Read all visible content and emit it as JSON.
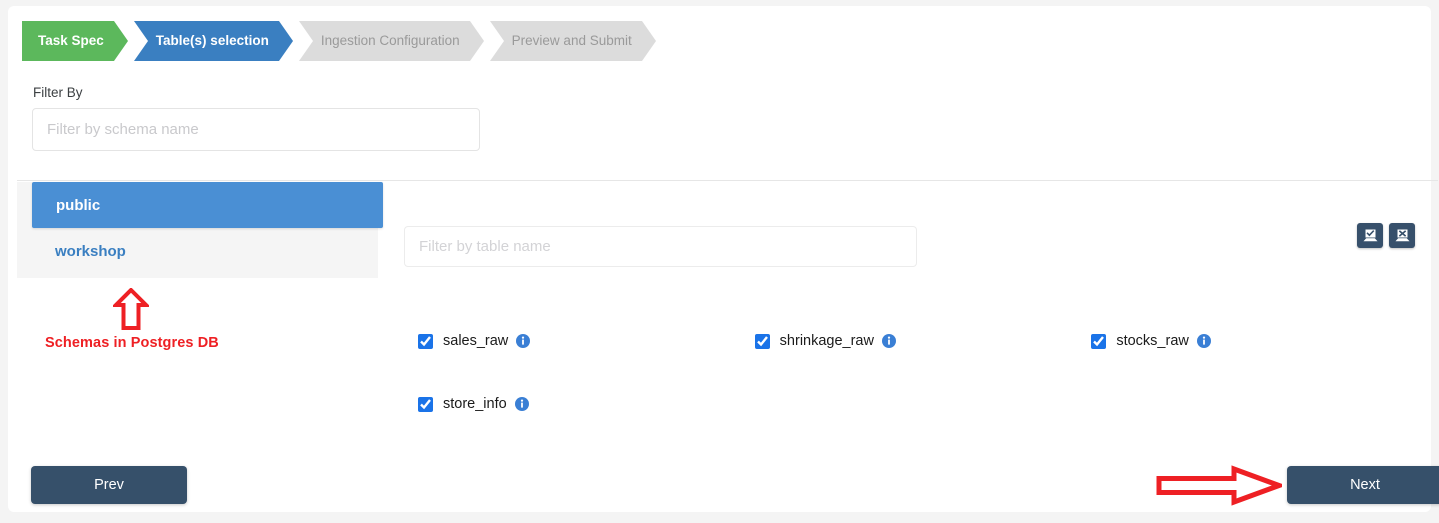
{
  "wizard": {
    "steps": [
      {
        "label": "Task Spec",
        "state": "done"
      },
      {
        "label": "Table(s) selection",
        "state": "active"
      },
      {
        "label": "Ingestion Configuration",
        "state": "todo"
      },
      {
        "label": "Preview and Submit",
        "state": "todo"
      }
    ]
  },
  "schema_filter": {
    "label": "Filter By",
    "placeholder": "Filter by schema name",
    "value": ""
  },
  "sidebar": {
    "items": [
      {
        "label": "public",
        "selected": true
      },
      {
        "label": "workshop",
        "selected": false
      }
    ]
  },
  "annotations": {
    "up_arrow_caption": "Schemas in Postgres DB",
    "color": "#ee2024"
  },
  "table_filter": {
    "placeholder": "Filter by table name",
    "value": ""
  },
  "bulk_actions": [
    {
      "name": "select-all",
      "icon": "check-all-icon"
    },
    {
      "name": "deselect-all",
      "icon": "uncheck-all-icon"
    }
  ],
  "tables": [
    {
      "name": "sales_raw",
      "checked": true,
      "info": "info-icon"
    },
    {
      "name": "shrinkage_raw",
      "checked": true,
      "info": "info-icon"
    },
    {
      "name": "stocks_raw",
      "checked": true,
      "info": "info-icon"
    },
    {
      "name": "store_info",
      "checked": true,
      "info": "info-icon"
    }
  ],
  "footer": {
    "prev_label": "Prev",
    "next_label": "Next"
  },
  "colors": {
    "step_done": "#5cb85c",
    "step_active": "#3a7fc1",
    "step_todo": "#dcdcdc",
    "sidebar_selected": "#4a8fd4",
    "button": "#36506a",
    "checkbox": "#1a73e8",
    "annotation": "#ee2024"
  }
}
